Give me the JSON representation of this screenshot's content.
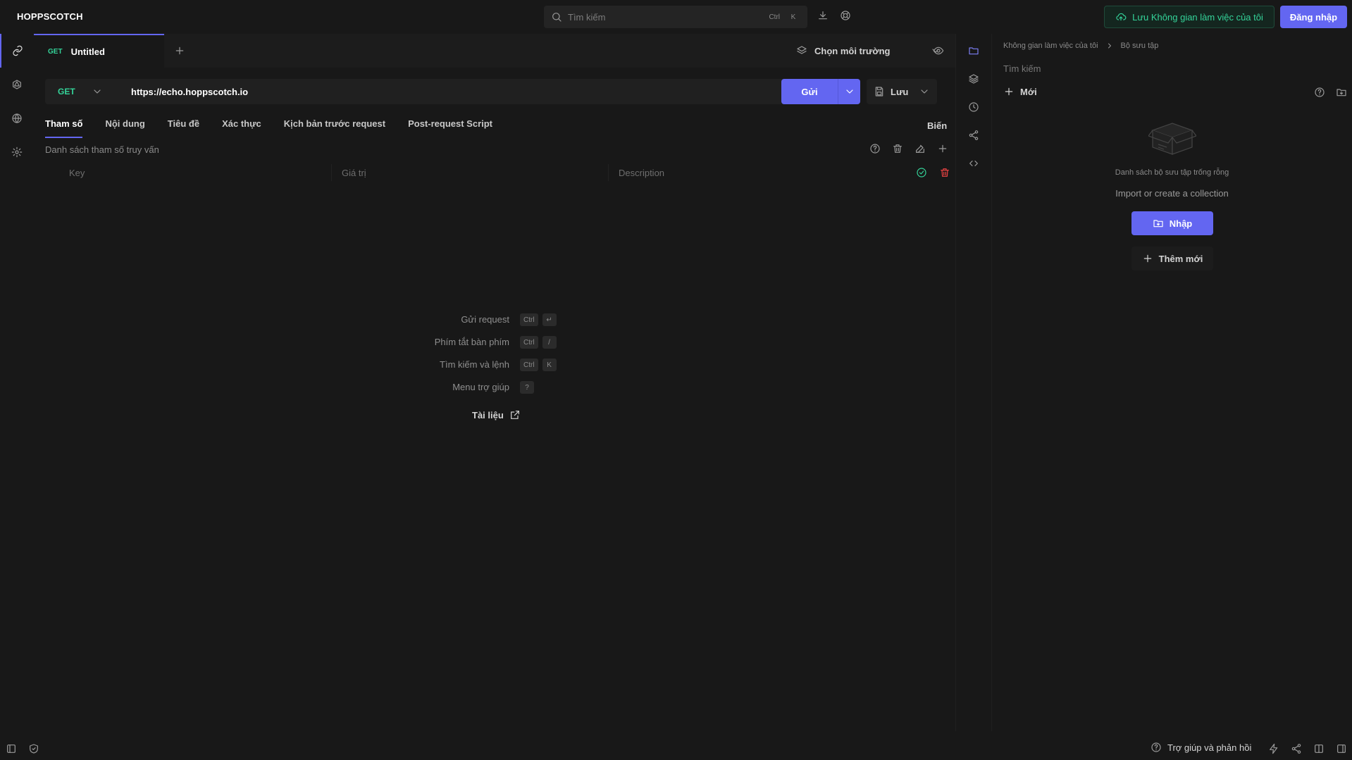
{
  "header": {
    "brand": "HOPPSCOTCH",
    "search_placeholder": "Tìm kiếm",
    "search_shortcut": [
      "Ctrl",
      "K"
    ],
    "save_workspace_label": "Lưu Không gian làm việc của tôi",
    "login_label": "Đăng nhập"
  },
  "tabs": {
    "items": [
      {
        "method": "GET",
        "title": "Untitled"
      }
    ],
    "env_select_label": "Chọn môi trường"
  },
  "request": {
    "method": "GET",
    "url": "https://echo.hoppscotch.io",
    "send_label": "Gửi",
    "save_label": "Lưu",
    "tabs": [
      "Tham số",
      "Nội dung",
      "Tiêu đề",
      "Xác thực",
      "Kịch bản trước request",
      "Post-request Script"
    ],
    "variables_label": "Biến",
    "params_title": "Danh sách tham số truy vấn",
    "columns": {
      "key": "Key",
      "value": "Giá trị",
      "description": "Description"
    }
  },
  "shortcuts": [
    {
      "label": "Gửi request",
      "keys": [
        "Ctrl",
        "↵"
      ]
    },
    {
      "label": "Phím tắt bàn phím",
      "keys": [
        "Ctrl",
        "/"
      ]
    },
    {
      "label": "Tìm kiếm và lệnh",
      "keys": [
        "Ctrl",
        "K"
      ]
    },
    {
      "label": "Menu trợ giúp",
      "keys": [
        "?"
      ]
    }
  ],
  "docs_label": "Tài liệu",
  "collections": {
    "breadcrumb": [
      "Không gian làm việc của tôi",
      "Bộ sưu tập"
    ],
    "search_placeholder": "Tìm kiếm",
    "new_label": "Mới",
    "empty_text": "Danh sách bộ sưu tập trống rỗng",
    "empty_sub": "Import or create a collection",
    "import_label": "Nhập",
    "add_new_label": "Thêm mới"
  },
  "footer": {
    "help_label": "Trợ giúp và phản hồi"
  },
  "colors": {
    "accent": "#6366f1",
    "success": "#34d399",
    "danger": "#ef4444",
    "background": "#181818"
  }
}
